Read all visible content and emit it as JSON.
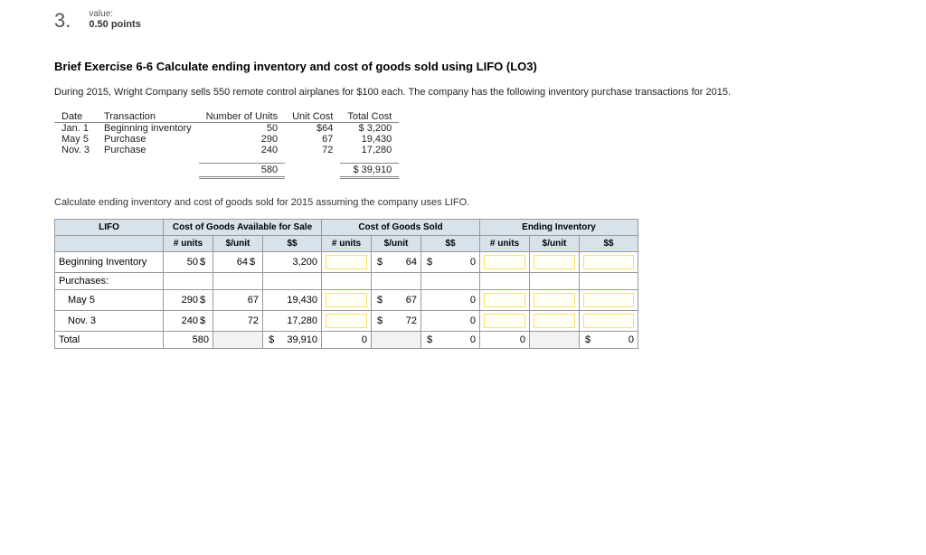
{
  "question": {
    "number": "3.",
    "value_label": "value:",
    "points": "0.50 points"
  },
  "title": "Brief Exercise 6-6 Calculate ending inventory and cost of goods sold using LIFO (LO3)",
  "intro1": "During 2015, Wright Company sells 550 remote control airplanes for $100 each. The company has the following inventory purchase transactions for 2015.",
  "inv_headers": {
    "date": "Date",
    "transaction": "Transaction",
    "units": "Number of Units",
    "unit_cost": "Unit Cost",
    "total_cost": "Total Cost"
  },
  "inv_rows": [
    {
      "date": "Jan. 1",
      "txn": "Beginning inventory",
      "units": "50",
      "unit_cost": "$64",
      "total": "$ 3,200"
    },
    {
      "date": "May 5",
      "txn": "Purchase",
      "units": "290",
      "unit_cost": "67",
      "total": "19,430"
    },
    {
      "date": "Nov. 3",
      "txn": "Purchase",
      "units": "240",
      "unit_cost": "72",
      "total": "17,280"
    }
  ],
  "inv_totals": {
    "units": "580",
    "total": "$ 39,910"
  },
  "instruct": "Calculate ending inventory and cost of goods sold for 2015 assuming the company uses LIFO.",
  "lifo": {
    "corner": "LIFO",
    "group_headers": {
      "cogas": "Cost of Goods Available for Sale",
      "cogs": "Cost of Goods Sold",
      "ending": "Ending Inventory"
    },
    "sub_headers": {
      "units": "# units",
      "unit_cost": "$/unit",
      "dollars": "$$"
    },
    "row_labels": {
      "beginning": "Beginning Inventory",
      "purchases": "Purchases:",
      "may5": "May 5",
      "nov3": "Nov. 3",
      "total": "Total"
    },
    "data": {
      "beg": {
        "units": "50",
        "dollar": "$",
        "ucost": "64",
        "dollar2": "$",
        "total": "3,200",
        "cogs_d": "$",
        "cogs_ucost": "64",
        "cogs_d2": "$",
        "cogs_val": "0"
      },
      "may5": {
        "units": "290",
        "dollar": "$",
        "ucost": "67",
        "total": "19,430",
        "cogs_d": "$",
        "cogs_ucost": "67",
        "cogs_val": "0"
      },
      "nov3": {
        "units": "240",
        "dollar": "$",
        "ucost": "72",
        "total": "17,280",
        "cogs_d": "$",
        "cogs_ucost": "72",
        "cogs_val": "0"
      },
      "total": {
        "units": "580",
        "dollar": "$",
        "total": "39,910",
        "cogs_units": "0",
        "cogs_d": "$",
        "cogs_val": "0",
        "end_units": "0",
        "end_d": "$",
        "end_val": "0"
      }
    }
  }
}
